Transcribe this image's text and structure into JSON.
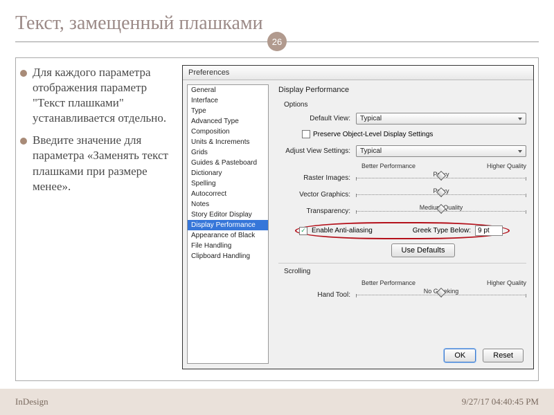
{
  "slide": {
    "title": "Текст, замещенный плашками",
    "page_number": "26",
    "bullets": [
      "Для каждого параметра отображения параметр \"Текст плашками\" устанавливается отдельно.",
      "Введите значение для параметра «Заменять текст плашками при размере менее»."
    ]
  },
  "dialog": {
    "title": "Preferences",
    "categories": [
      "General",
      "Interface",
      "Type",
      "Advanced Type",
      "Composition",
      "Units & Increments",
      "Grids",
      "Guides & Pasteboard",
      "Dictionary",
      "Spelling",
      "Autocorrect",
      "Notes",
      "Story Editor Display",
      "Display Performance",
      "Appearance of Black",
      "File Handling",
      "Clipboard Handling"
    ],
    "selected_category": "Display Performance",
    "panel_title": "Display Performance",
    "options_label": "Options",
    "default_view_label": "Default View:",
    "default_view_value": "Typical",
    "preserve_obj_label": "Preserve Object-Level Display Settings",
    "preserve_obj_checked": false,
    "adjust_view_label": "Adjust View Settings:",
    "adjust_view_value": "Typical",
    "scale_left": "Better Performance",
    "scale_right": "Higher Quality",
    "raster_label": "Raster Images:",
    "raster_value": "Proxy",
    "vector_label": "Vector Graphics:",
    "vector_value": "Proxy",
    "trans_label": "Transparency:",
    "trans_value": "Medium Quality",
    "enable_aa_label": "Enable Anti-aliasing",
    "enable_aa_checked": true,
    "greek_label": "Greek Type Below:",
    "greek_value": "9 pt",
    "use_defaults": "Use Defaults",
    "scrolling_label": "Scrolling",
    "hand_tool_label": "Hand Tool:",
    "hand_tool_value": "No Greeking",
    "ok": "OK",
    "reset": "Reset"
  },
  "footer": {
    "left": "InDesign",
    "right": "9/27/17 04:40:45 PM"
  }
}
